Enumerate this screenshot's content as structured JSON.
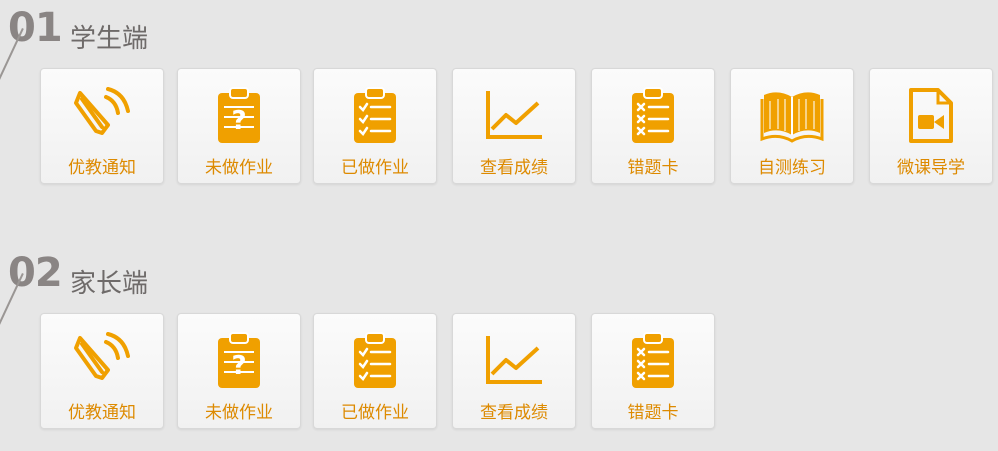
{
  "sections": [
    {
      "number": "01",
      "title": "学生端",
      "tiles": [
        {
          "label": "优教通知",
          "icon": "speaker-icon"
        },
        {
          "label": "未做作业",
          "icon": "clipboard-question-icon"
        },
        {
          "label": "已做作业",
          "icon": "clipboard-check-icon"
        },
        {
          "label": "查看成绩",
          "icon": "line-chart-icon"
        },
        {
          "label": "错题卡",
          "icon": "clipboard-x-icon"
        },
        {
          "label": "自测练习",
          "icon": "open-book-icon"
        },
        {
          "label": "微课导学",
          "icon": "video-file-icon"
        }
      ]
    },
    {
      "number": "02",
      "title": "家长端",
      "tiles": [
        {
          "label": "优教通知",
          "icon": "speaker-icon"
        },
        {
          "label": "未做作业",
          "icon": "clipboard-question-icon"
        },
        {
          "label": "已做作业",
          "icon": "clipboard-check-icon"
        },
        {
          "label": "查看成绩",
          "icon": "line-chart-icon"
        },
        {
          "label": "错题卡",
          "icon": "clipboard-x-icon"
        }
      ]
    }
  ],
  "colors": {
    "accent": "#f0a000",
    "label": "#dd8a00",
    "background": "#e6e6e6",
    "section_number": "#8a8584"
  }
}
